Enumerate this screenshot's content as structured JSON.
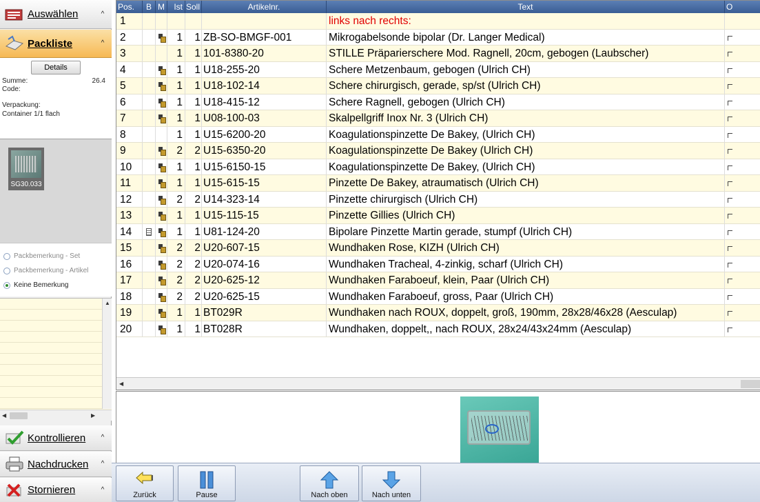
{
  "nav": {
    "auswaehlen": "Auswählen",
    "packliste": "Packliste",
    "kontrollieren": "Kontrollieren",
    "nachdrucken": "Nachdrucken",
    "stornieren": "Stornieren",
    "chevron": "^"
  },
  "info": {
    "details_button": "Details",
    "summe_label": "Summe:",
    "summe_value": "26.4",
    "code_label": "Code:",
    "verpackung_label": "Verpackung:",
    "verpackung_value": "Container 1/1 flach",
    "thumb_caption": "SG30.033"
  },
  "bemerkung": {
    "options": [
      "Packbemerkung - Set",
      "Packbemerkung - Artikel",
      "Keine Bemerkung"
    ],
    "selected": "Keine Bemerkung"
  },
  "grid": {
    "headers": {
      "pos": "Pos.",
      "b": "B",
      "m": "M",
      "ist": "Ist",
      "soll": "Soll",
      "artikelnr": "Artikelnr.",
      "text": "Text",
      "o": "O"
    },
    "rows": [
      {
        "pos": "1",
        "b": "",
        "m": "",
        "ist": "",
        "soll": "",
        "art": "",
        "text": "links nach rechts:",
        "red": true
      },
      {
        "pos": "2",
        "b": "",
        "m": "icon",
        "ist": "1",
        "soll": "1",
        "art": "ZB-SO-BMGF-001",
        "text": "Mikrogabelsonde bipolar (Dr. Langer Medical)"
      },
      {
        "pos": "3",
        "b": "",
        "m": "",
        "ist": "1",
        "soll": "1",
        "art": "101-8380-20",
        "text": "STILLE Präparierschere Mod. Ragnell, 20cm, gebogen (Laubscher)"
      },
      {
        "pos": "4",
        "b": "",
        "m": "icon",
        "ist": "1",
        "soll": "1",
        "art": "U18-255-20",
        "text": "Schere Metzenbaum, gebogen (Ulrich CH)"
      },
      {
        "pos": "5",
        "b": "",
        "m": "icon",
        "ist": "1",
        "soll": "1",
        "art": "U18-102-14",
        "text": "Schere chirurgisch, gerade, sp/st (Ulrich CH)"
      },
      {
        "pos": "6",
        "b": "",
        "m": "icon",
        "ist": "1",
        "soll": "1",
        "art": "U18-415-12",
        "text": "Schere Ragnell, gebogen (Ulrich CH)"
      },
      {
        "pos": "7",
        "b": "",
        "m": "icon",
        "ist": "1",
        "soll": "1",
        "art": "U08-100-03",
        "text": "Skalpellgriff Inox Nr. 3 (Ulrich CH)"
      },
      {
        "pos": "8",
        "b": "",
        "m": "",
        "ist": "1",
        "soll": "1",
        "art": "U15-6200-20",
        "text": "Koagulationspinzette De Bakey, (Ulrich CH)"
      },
      {
        "pos": "9",
        "b": "",
        "m": "icon",
        "ist": "2",
        "soll": "2",
        "art": "U15-6350-20",
        "text": "Koagulationspinzette De Bakey (Ulrich CH)"
      },
      {
        "pos": "10",
        "b": "",
        "m": "icon",
        "ist": "1",
        "soll": "1",
        "art": "U15-6150-15",
        "text": "Koagulationspinzette De Bakey, (Ulrich CH)"
      },
      {
        "pos": "11",
        "b": "",
        "m": "icon",
        "ist": "1",
        "soll": "1",
        "art": "U15-615-15",
        "text": "Pinzette De Bakey, atraumatisch (Ulrich CH)"
      },
      {
        "pos": "12",
        "b": "",
        "m": "icon",
        "ist": "2",
        "soll": "2",
        "art": "U14-323-14",
        "text": "Pinzette chirurgisch (Ulrich CH)"
      },
      {
        "pos": "13",
        "b": "",
        "m": "icon",
        "ist": "1",
        "soll": "1",
        "art": "U15-115-15",
        "text": "Pinzette Gillies (Ulrich CH)"
      },
      {
        "pos": "14",
        "b": "icon",
        "m": "icon",
        "ist": "1",
        "soll": "1",
        "art": "U81-124-20",
        "text": "Bipolare Pinzette Martin gerade, stumpf (Ulrich CH)"
      },
      {
        "pos": "15",
        "b": "",
        "m": "icon",
        "ist": "2",
        "soll": "2",
        "art": "U20-607-15",
        "text": "Wundhaken Rose, KIZH (Ulrich CH)"
      },
      {
        "pos": "16",
        "b": "",
        "m": "icon",
        "ist": "2",
        "soll": "2",
        "art": "U20-074-16",
        "text": "Wundhaken Tracheal, 4-zinkig, scharf (Ulrich CH)"
      },
      {
        "pos": "17",
        "b": "",
        "m": "icon",
        "ist": "2",
        "soll": "2",
        "art": "U20-625-12",
        "text": "Wundhaken Faraboeuf, klein, Paar (Ulrich CH)"
      },
      {
        "pos": "18",
        "b": "",
        "m": "icon",
        "ist": "2",
        "soll": "2",
        "art": "U20-625-15",
        "text": "Wundhaken Faraboeuf, gross, Paar (Ulrich CH)"
      },
      {
        "pos": "19",
        "b": "",
        "m": "icon",
        "ist": "1",
        "soll": "1",
        "art": "BT029R",
        "text": "Wundhaken nach ROUX, doppelt, groß, 190mm, 28x28/46x28 (Aesculap)"
      },
      {
        "pos": "20",
        "b": "",
        "m": "icon",
        "ist": "1",
        "soll": "1",
        "art": "BT028R",
        "text": "Wundhaken,  doppelt,, nach ROUX, 28x24/43x24mm (Aesculap)"
      }
    ]
  },
  "toolbar": {
    "zurueck": "Zurück",
    "pause": "Pause",
    "nach_oben": "Nach oben",
    "nach_unten": "Nach unten"
  },
  "colors": {
    "header_blue": "#3a5d94",
    "row_cream": "#fffbe1",
    "accent_orange": "#f6b954",
    "red_text": "#e00000"
  }
}
